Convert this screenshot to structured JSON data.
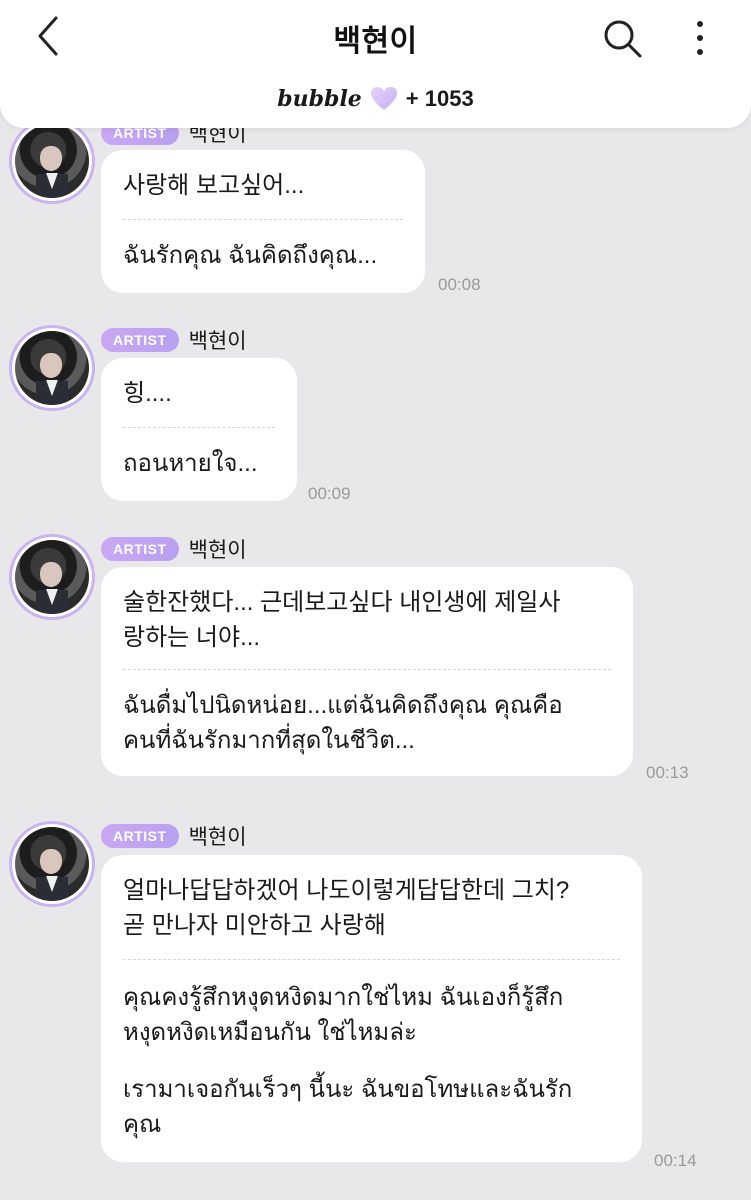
{
  "header": {
    "title": "백현이",
    "brand": "bubble",
    "count": "+ 1053",
    "accent_color": "#c9b3f0",
    "icons": [
      "back-icon",
      "search-icon",
      "more-icon",
      "heart-icon"
    ]
  },
  "messages": [
    {
      "badge": "ARTIST",
      "name": "백현이",
      "lines": [
        "사랑해 보고싶어...",
        "ฉันรักคุณ ฉันคิดถึงคุณ..."
      ],
      "time": "00:08"
    },
    {
      "badge": "ARTIST",
      "name": "백현이",
      "lines": [
        "힝....",
        "ถอนหายใจ..."
      ],
      "time": "00:09"
    },
    {
      "badge": "ARTIST",
      "name": "백현이",
      "lines": [
        "술한잔했다... 근데보고싶다 내인생에 제일사",
        "랑하는 너야...",
        "ฉันดื่มไปนิดหน่อย...แต่ฉันคิดถึงคุณ คุณคือ",
        "คนที่ฉันรักมากที่สุดในชีวิต..."
      ],
      "time": "00:13"
    },
    {
      "badge": "ARTIST",
      "name": "백현이",
      "lines": [
        "얼마나답답하겠어 나도이렇게답답한데 그치?",
        "곧 만나자 미안하고 사랑해",
        "คุณคงรู้สึกหงุดหงิดมากใช่ไหม ฉันเองก็รู้สึก",
        "หงุดหงิดเหมือนกัน ใช่ไหมล่ะ",
        "เรามาเจอกันเร็วๆ นี้นะ ฉันขอโทษและฉันรัก",
        "คุณ"
      ],
      "time": "00:14"
    }
  ]
}
